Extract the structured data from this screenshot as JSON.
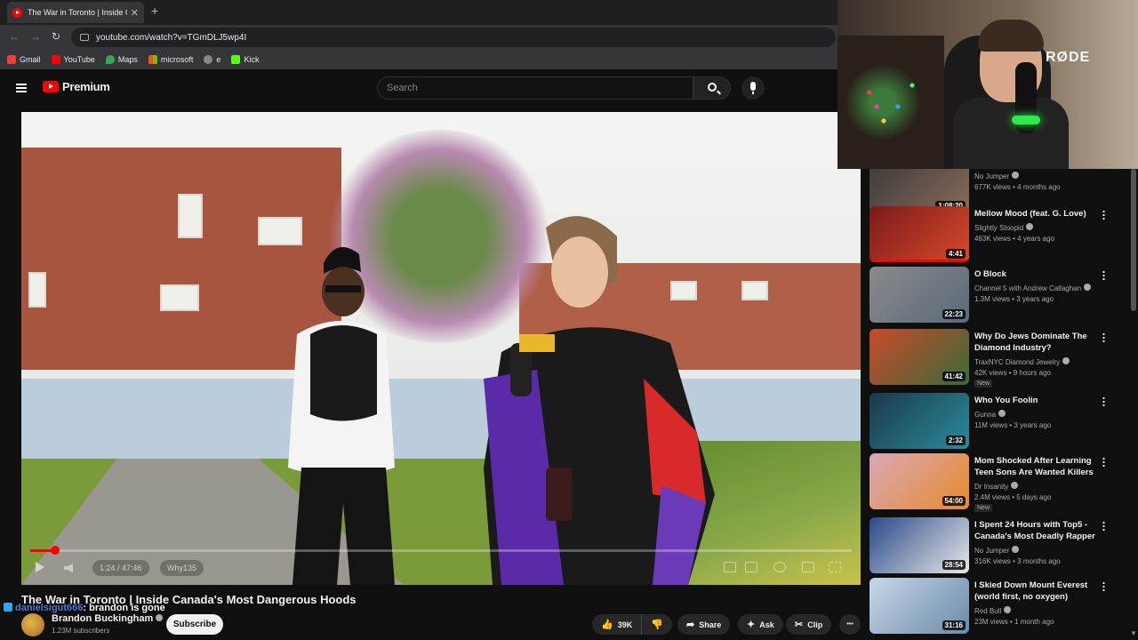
{
  "browser": {
    "tab_title": "The War in Toronto | Inside Can",
    "new_tab": "+",
    "url": "youtube.com/watch?v=TGmDLJ5wp4I",
    "bookmarks": [
      {
        "label": "Gmail",
        "color": "#ea4335"
      },
      {
        "label": "YouTube",
        "color": "#ff0000"
      },
      {
        "label": "Maps",
        "color": "#34a853"
      },
      {
        "label": "microsoft",
        "color": "#00a4ef"
      },
      {
        "label": "e",
        "color": "#888888"
      },
      {
        "label": "Kick",
        "color": "#53fc18"
      }
    ]
  },
  "youtube": {
    "brand": "Premium",
    "search_placeholder": "Search"
  },
  "player": {
    "time": "1:24 / 47:46",
    "chapter": "Why135",
    "progress_fraction": 0.03
  },
  "video": {
    "title": "The War in Toronto | Inside Canada's Most Dangerous Hoods",
    "channel": "Brandon Buckingham",
    "subscribers": "1.23M subscribers",
    "subscribe_label": "Subscribe",
    "likes": "39K",
    "share_label": "Share",
    "ask_label": "Ask",
    "clip_label": "Clip",
    "more_label": "•••"
  },
  "chat_overlay": {
    "user": "danielsigut666",
    "message": ": brandon is gone"
  },
  "recommendations": [
    {
      "title": "",
      "channel": "No Jumper",
      "meta": "677K views • 4 months ago",
      "duration": "1:08:20",
      "badge": "",
      "colors": [
        "#3a3a3a",
        "#8a6a5a"
      ]
    },
    {
      "title": "Mellow Mood (feat. G. Love)",
      "channel": "Slightly Stoopid",
      "meta": "463K views • 4 years ago",
      "duration": "4:41",
      "badge": "",
      "colors": [
        "#7a1a1a",
        "#d84a2a"
      ]
    },
    {
      "title": "O Block",
      "channel": "Channel 5 with Andrew Callaghan",
      "meta": "1.3M views • 3 years ago",
      "duration": "22:23",
      "badge": "",
      "colors": [
        "#8a8a8a",
        "#5a6a7a"
      ]
    },
    {
      "title": "Why Do Jews Dominate The Diamond Industry?",
      "channel": "TraxNYC Diamond Jewelry",
      "meta": "42K views • 9 hours ago",
      "duration": "41:42",
      "badge": "New",
      "colors": [
        "#c84a2a",
        "#3a6a3a"
      ]
    },
    {
      "title": "Who You Foolin",
      "channel": "Gunna",
      "meta": "11M views • 3 years ago",
      "duration": "2:32",
      "badge": "",
      "colors": [
        "#1a3a4a",
        "#2a8a9a"
      ]
    },
    {
      "title": "Mom Shocked After Learning Teen Sons Are Wanted Killers",
      "channel": "Dr Insanity",
      "meta": "2.4M views • 5 days ago",
      "duration": "54:00",
      "badge": "New",
      "colors": [
        "#d8a8b8",
        "#e88a2a"
      ]
    },
    {
      "title": "I Spent 24 Hours with Top5 - Canada's Most Deadly Rapper",
      "channel": "No Jumper",
      "meta": "316K views • 3 months ago",
      "duration": "28:54",
      "badge": "",
      "colors": [
        "#2a4a8a",
        "#e8e8e8"
      ]
    },
    {
      "title": "I Skied Down Mount Everest (world first, no oxygen)",
      "channel": "Red Bull",
      "meta": "23M views • 1 month ago",
      "duration": "31:16",
      "badge": "",
      "colors": [
        "#c8d8e8",
        "#6a8aa8"
      ]
    }
  ],
  "webcam": {
    "mic_brand": "RØDE"
  }
}
